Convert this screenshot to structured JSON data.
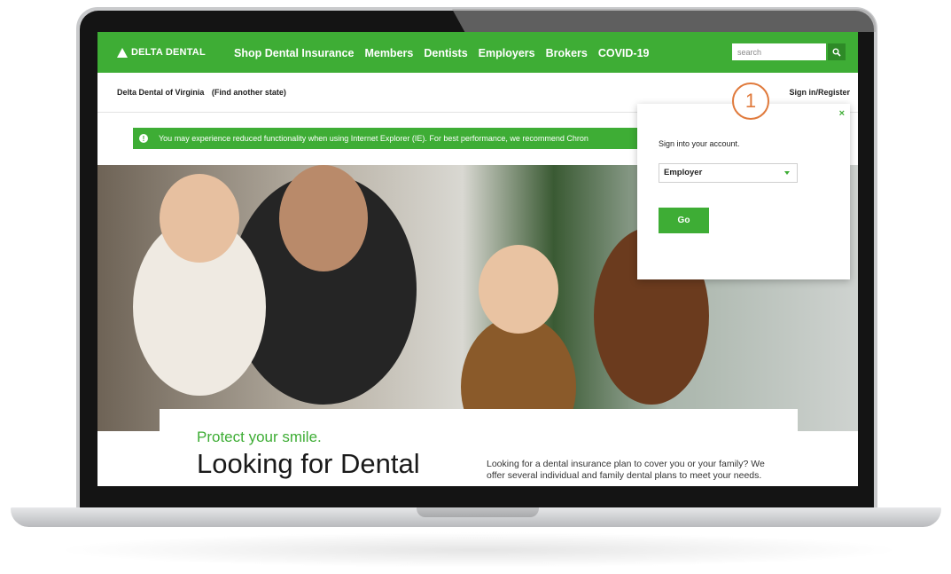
{
  "site": {
    "logo_text": "DELTA DENTAL",
    "nav": [
      "Shop Dental Insurance",
      "Members",
      "Dentists",
      "Employers",
      "Brokers",
      "COVID-19"
    ],
    "search": {
      "placeholder": "search"
    }
  },
  "subbar": {
    "state": "Delta Dental of Virginia",
    "find_state": "(Find another state)",
    "signin": "Sign in/Register"
  },
  "banner": {
    "text": "You may experience reduced functionality when using Internet Explorer (IE). For best performance, we recommend Chron"
  },
  "hero": {
    "tagline": "Protect your smile.",
    "headline": "Looking for Dental",
    "description": "Looking for a dental insurance plan to cover you or your family? We offer several individual and family dental plans to meet your needs."
  },
  "signin_popover": {
    "close": "×",
    "title": "Sign into your account.",
    "selected_account": "Employer",
    "go_label": "Go"
  },
  "annotation": {
    "step": "1"
  },
  "colors": {
    "brand_green": "#3ead35",
    "annotation_orange": "#e07a3c"
  }
}
